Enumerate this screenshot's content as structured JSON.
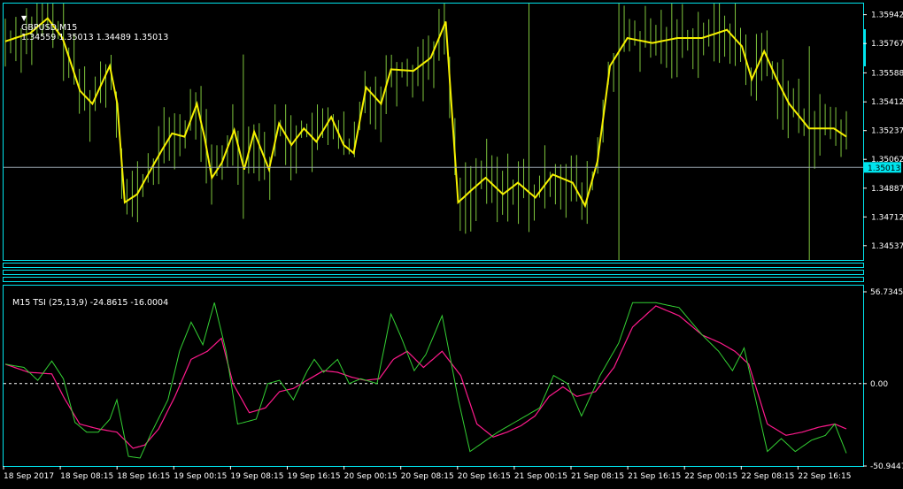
{
  "colors": {
    "background": "#000000",
    "frame": "#00e5ee",
    "grid_text": "#ffffff",
    "price_bars": "#7fc63d",
    "moving_average": "#f5f000",
    "tsi_line": "#33d033",
    "signal_line": "#ff1a8c",
    "zero_line": "#ffffff"
  },
  "header": {
    "symbol_text": "GBPUSD,M15",
    "ohlc_text": "1.34559 1.35013 1.34489 1.35013",
    "menu_icon": "triangle-down-icon"
  },
  "indicator_header": {
    "text": "M15 TSI (25,13,9) -24.8615 -16.0004"
  },
  "main_axis": {
    "labels": [
      "1.35942",
      "1.35767",
      "1.35588",
      "1.35412",
      "1.35237",
      "1.35062",
      "1.34887",
      "1.34712",
      "1.34537"
    ],
    "current_price": "1.35013"
  },
  "indicator_axis": {
    "labels": [
      "56.7345",
      "0.00",
      "-50.9447"
    ]
  },
  "time_axis": {
    "labels": [
      "18 Sep 2017",
      "18 Sep 08:15",
      "18 Sep 16:15",
      "19 Sep 00:15",
      "19 Sep 08:15",
      "19 Sep 16:15",
      "20 Sep 00:15",
      "20 Sep 08:15",
      "20 Sep 16:15",
      "21 Sep 00:15",
      "21 Sep 08:15",
      "21 Sep 16:15",
      "22 Sep 00:15",
      "22 Sep 08:15",
      "22 Sep 16:15"
    ]
  },
  "chart_data": [
    {
      "type": "line",
      "title": "GBPUSD,M15",
      "ylim": [
        1.3445,
        1.3601
      ],
      "bar_count": 160,
      "series": [
        {
          "name": "price_ma_keypoints",
          "values": [
            [
              0,
              1.3578
            ],
            [
              10,
              1.3583
            ],
            [
              17,
              1.3592
            ],
            [
              23,
              1.358
            ],
            [
              30,
              1.3548
            ],
            [
              35,
              1.354
            ],
            [
              42,
              1.3563
            ],
            [
              45,
              1.354
            ],
            [
              48,
              1.348
            ],
            [
              53,
              1.3485
            ],
            [
              57,
              1.3496
            ],
            [
              63,
              1.3512
            ],
            [
              67,
              1.3522
            ],
            [
              72,
              1.352
            ],
            [
              77,
              1.354
            ],
            [
              80,
              1.352
            ],
            [
              83,
              1.3495
            ],
            [
              87,
              1.3504
            ],
            [
              92,
              1.3524
            ],
            [
              96,
              1.35
            ],
            [
              100,
              1.3523
            ],
            [
              106,
              1.35
            ],
            [
              110,
              1.3528
            ],
            [
              115,
              1.3515
            ],
            [
              120,
              1.3525
            ],
            [
              125,
              1.3517
            ],
            [
              131,
              1.3532
            ],
            [
              136,
              1.3515
            ],
            [
              140,
              1.351
            ],
            [
              145,
              1.355
            ],
            [
              151,
              1.354
            ],
            [
              155,
              1.3561
            ],
            [
              164,
              1.356
            ],
            [
              171,
              1.3568
            ],
            [
              177,
              1.359
            ],
            [
              182,
              1.348
            ],
            [
              187,
              1.3487
            ],
            [
              193,
              1.3495
            ],
            [
              200,
              1.3485
            ],
            [
              206,
              1.3492
            ],
            [
              213,
              1.3483
            ],
            [
              220,
              1.3497
            ],
            [
              228,
              1.3492
            ],
            [
              233,
              1.3478
            ],
            [
              238,
              1.3505
            ],
            [
              243,
              1.3563
            ],
            [
              250,
              1.358
            ],
            [
              260,
              1.3577
            ],
            [
              270,
              1.358
            ],
            [
              280,
              1.358
            ],
            [
              290,
              1.3585
            ],
            [
              296,
              1.3575
            ],
            [
              300,
              1.3555
            ],
            [
              305,
              1.3572
            ],
            [
              310,
              1.3555
            ],
            [
              315,
              1.354
            ],
            [
              323,
              1.3525
            ],
            [
              333,
              1.3525
            ],
            [
              338,
              1.352
            ]
          ]
        },
        {
          "name": "current_price",
          "values": [
            [
              0,
              1.35013
            ]
          ]
        }
      ]
    },
    {
      "type": "line",
      "title": "M15 TSI (25,13,9)",
      "ylim": [
        -50.9447,
        56.7345
      ],
      "series": [
        {
          "name": "tsi",
          "values": [
            [
              0,
              12
            ],
            [
              8,
              10
            ],
            [
              14,
              2
            ],
            [
              20,
              14
            ],
            [
              25,
              3
            ],
            [
              30,
              -24
            ],
            [
              35,
              -30
            ],
            [
              40,
              -30
            ],
            [
              45,
              -22
            ],
            [
              48,
              -10
            ],
            [
              53,
              -45
            ],
            [
              58,
              -46
            ],
            [
              63,
              -30
            ],
            [
              70,
              -10
            ],
            [
              75,
              20
            ],
            [
              80,
              38
            ],
            [
              85,
              24
            ],
            [
              90,
              50
            ],
            [
              95,
              20
            ],
            [
              100,
              -25
            ],
            [
              108,
              -22
            ],
            [
              113,
              0
            ],
            [
              118,
              2
            ],
            [
              124,
              -10
            ],
            [
              130,
              8
            ],
            [
              133,
              15
            ],
            [
              137,
              7
            ],
            [
              143,
              15
            ],
            [
              148,
              0
            ],
            [
              153,
              3
            ],
            [
              160,
              0
            ],
            [
              166,
              43
            ],
            [
              170,
              30
            ],
            [
              176,
              8
            ],
            [
              181,
              18
            ],
            [
              188,
              42
            ],
            [
              195,
              -10
            ],
            [
              200,
              -42
            ],
            [
              206,
              -36
            ],
            [
              212,
              -30
            ],
            [
              218,
              -25
            ],
            [
              224,
              -20
            ],
            [
              230,
              -15
            ],
            [
              236,
              5
            ],
            [
              242,
              0
            ],
            [
              248,
              -20
            ],
            [
              256,
              5
            ],
            [
              264,
              25
            ],
            [
              270,
              50
            ],
            [
              280,
              50
            ],
            [
              290,
              47
            ],
            [
              300,
              30
            ],
            [
              307,
              20
            ],
            [
              313,
              8
            ],
            [
              318,
              22
            ],
            [
              323,
              -10
            ],
            [
              328,
              -42
            ],
            [
              334,
              -34
            ],
            [
              340,
              -42
            ],
            [
              347,
              -35
            ],
            [
              353,
              -32
            ],
            [
              357,
              -25
            ],
            [
              362,
              -43
            ]
          ]
        },
        {
          "name": "signal",
          "values": [
            [
              0,
              12
            ],
            [
              10,
              7
            ],
            [
              20,
              6
            ],
            [
              25,
              -8
            ],
            [
              32,
              -25
            ],
            [
              40,
              -28
            ],
            [
              48,
              -30
            ],
            [
              55,
              -40
            ],
            [
              60,
              -38
            ],
            [
              66,
              -28
            ],
            [
              73,
              -8
            ],
            [
              80,
              15
            ],
            [
              87,
              20
            ],
            [
              93,
              28
            ],
            [
              98,
              0
            ],
            [
              105,
              -18
            ],
            [
              112,
              -15
            ],
            [
              118,
              -5
            ],
            [
              124,
              -3
            ],
            [
              131,
              3
            ],
            [
              137,
              8
            ],
            [
              143,
              7
            ],
            [
              149,
              4
            ],
            [
              155,
              2
            ],
            [
              161,
              3
            ],
            [
              167,
              15
            ],
            [
              173,
              20
            ],
            [
              180,
              10
            ],
            [
              188,
              20
            ],
            [
              196,
              5
            ],
            [
              203,
              -25
            ],
            [
              210,
              -33
            ],
            [
              216,
              -30
            ],
            [
              222,
              -26
            ],
            [
              228,
              -20
            ],
            [
              234,
              -8
            ],
            [
              240,
              -2
            ],
            [
              246,
              -8
            ],
            [
              254,
              -5
            ],
            [
              262,
              10
            ],
            [
              270,
              35
            ],
            [
              280,
              48
            ],
            [
              290,
              42
            ],
            [
              300,
              30
            ],
            [
              308,
              25
            ],
            [
              314,
              20
            ],
            [
              320,
              12
            ],
            [
              328,
              -25
            ],
            [
              336,
              -32
            ],
            [
              343,
              -30
            ],
            [
              350,
              -27
            ],
            [
              357,
              -25
            ],
            [
              362,
              -28
            ]
          ]
        }
      ]
    }
  ]
}
